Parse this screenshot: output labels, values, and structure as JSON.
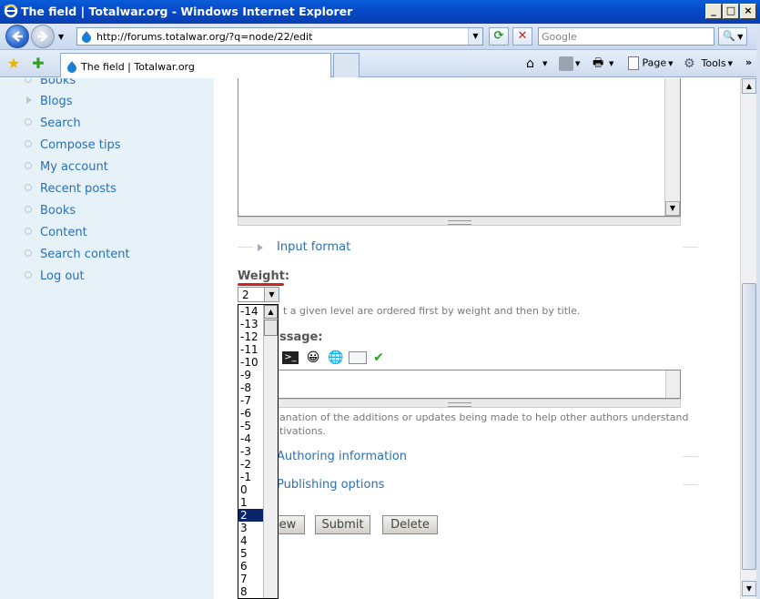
{
  "window": {
    "title": "The field | Totalwar.org - Windows Internet Explorer",
    "controls": [
      "_",
      "□",
      "×"
    ]
  },
  "addressbar": {
    "url": "http://forums.totalwar.org/?q=node/22/edit",
    "search_placeholder": "Google"
  },
  "tab": {
    "label": "The field | Totalwar.org"
  },
  "commandbar": {
    "page": "Page",
    "tools": "Tools"
  },
  "sidebar": {
    "items": [
      "Books",
      "Blogs",
      "Search",
      "Compose tips",
      "My account",
      "Recent posts",
      "Books",
      "Content",
      "Search content",
      "Log out"
    ]
  },
  "form": {
    "input_format": "Input format",
    "weight_label": "Weight:",
    "weight_value": "2",
    "weight_desc": "t a given level are ordered first by weight and then by title.",
    "log_label": "ssage:",
    "log_desc_1": "anation of the additions or updates being made to help other authors understand",
    "log_desc_2": "tivations.",
    "authoring": "Authoring information",
    "publishing": "Publishing options",
    "preview_btn": "ew",
    "submit_btn": "Submit",
    "delete_btn": "Delete"
  },
  "weight_options": [
    "-14",
    "-13",
    "-12",
    "-11",
    "-10",
    "-9",
    "-8",
    "-7",
    "-6",
    "-5",
    "-4",
    "-3",
    "-2",
    "-1",
    "0",
    "1",
    "2",
    "3",
    "4",
    "5",
    "6",
    "7",
    "8"
  ],
  "colors": {
    "link": "#2a6fb7",
    "sidebar_bg": "#e6f1f8",
    "selected": "#0a246a",
    "highlight": "#d21f1f"
  }
}
